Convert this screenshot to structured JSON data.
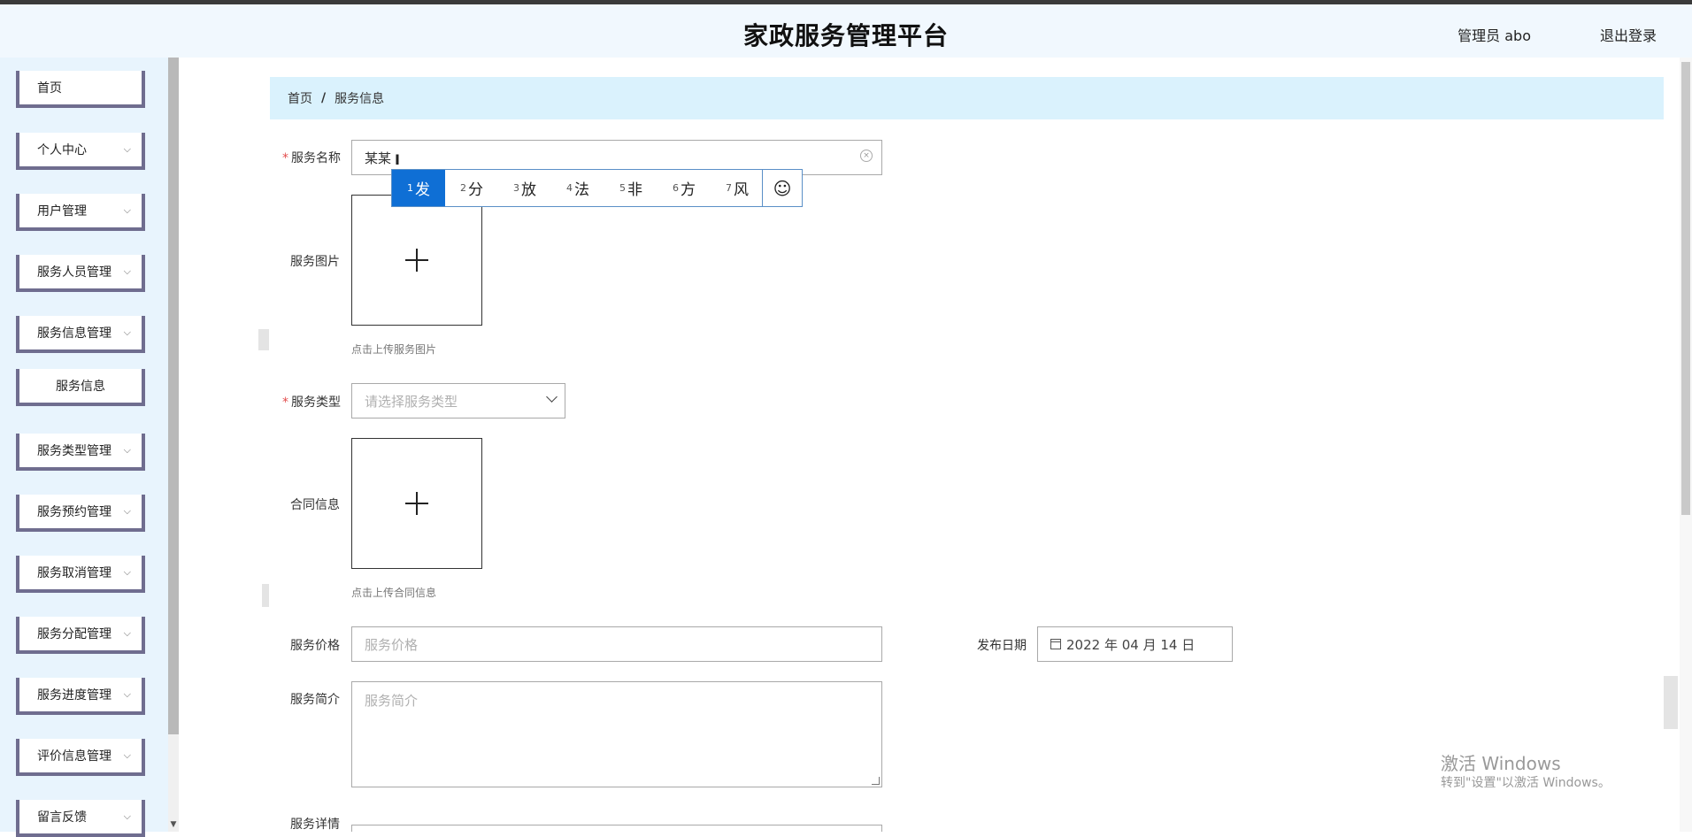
{
  "header": {
    "title": "家政服务管理平台",
    "admin": "管理员 abo",
    "logout": "退出登录"
  },
  "sidebar": {
    "items": [
      {
        "label": "首页"
      },
      {
        "label": "个人中心"
      },
      {
        "label": "用户管理"
      },
      {
        "label": "服务人员管理"
      },
      {
        "label": "服务信息管理"
      },
      {
        "label": "服务信息"
      },
      {
        "label": "服务类型管理"
      },
      {
        "label": "服务预约管理"
      },
      {
        "label": "服务取消管理"
      },
      {
        "label": "服务分配管理"
      },
      {
        "label": "服务进度管理"
      },
      {
        "label": "评价信息管理"
      },
      {
        "label": "留言反馈"
      }
    ]
  },
  "breadcrumb": {
    "home": "首页",
    "separator": "/",
    "current": "服务信息"
  },
  "form": {
    "name": {
      "label": "服务名称",
      "value": "某某"
    },
    "image": {
      "label": "服务图片",
      "hint": "点击上传服务图片"
    },
    "type": {
      "label": "服务类型",
      "placeholder": "请选择服务类型"
    },
    "contract": {
      "label": "合同信息",
      "hint": "点击上传合同信息"
    },
    "price": {
      "label": "服务价格",
      "placeholder": "服务价格"
    },
    "date": {
      "label": "发布日期",
      "value": "2022 年 04 月 14 日"
    },
    "intro": {
      "label": "服务简介",
      "placeholder": "服务简介"
    },
    "detail": {
      "label": "服务详情"
    }
  },
  "ime": {
    "candidates": [
      {
        "num": "1",
        "text": "发"
      },
      {
        "num": "2",
        "text": "分"
      },
      {
        "num": "3",
        "text": "放"
      },
      {
        "num": "4",
        "text": "法"
      },
      {
        "num": "5",
        "text": "非"
      },
      {
        "num": "6",
        "text": "方"
      },
      {
        "num": "7",
        "text": "风"
      }
    ],
    "emoji": "☺"
  },
  "watermark": {
    "line1": "激活 Windows",
    "line2": "转到\"设置\"以激活 Windows。"
  },
  "colors": {
    "header_bg": "#f1f8fe",
    "sidebar_bg": "#e8f4fd",
    "menu_border": "#6f6d8f",
    "breadcrumb_bg": "#daf2fd",
    "ime_active": "#0f6fd5"
  }
}
